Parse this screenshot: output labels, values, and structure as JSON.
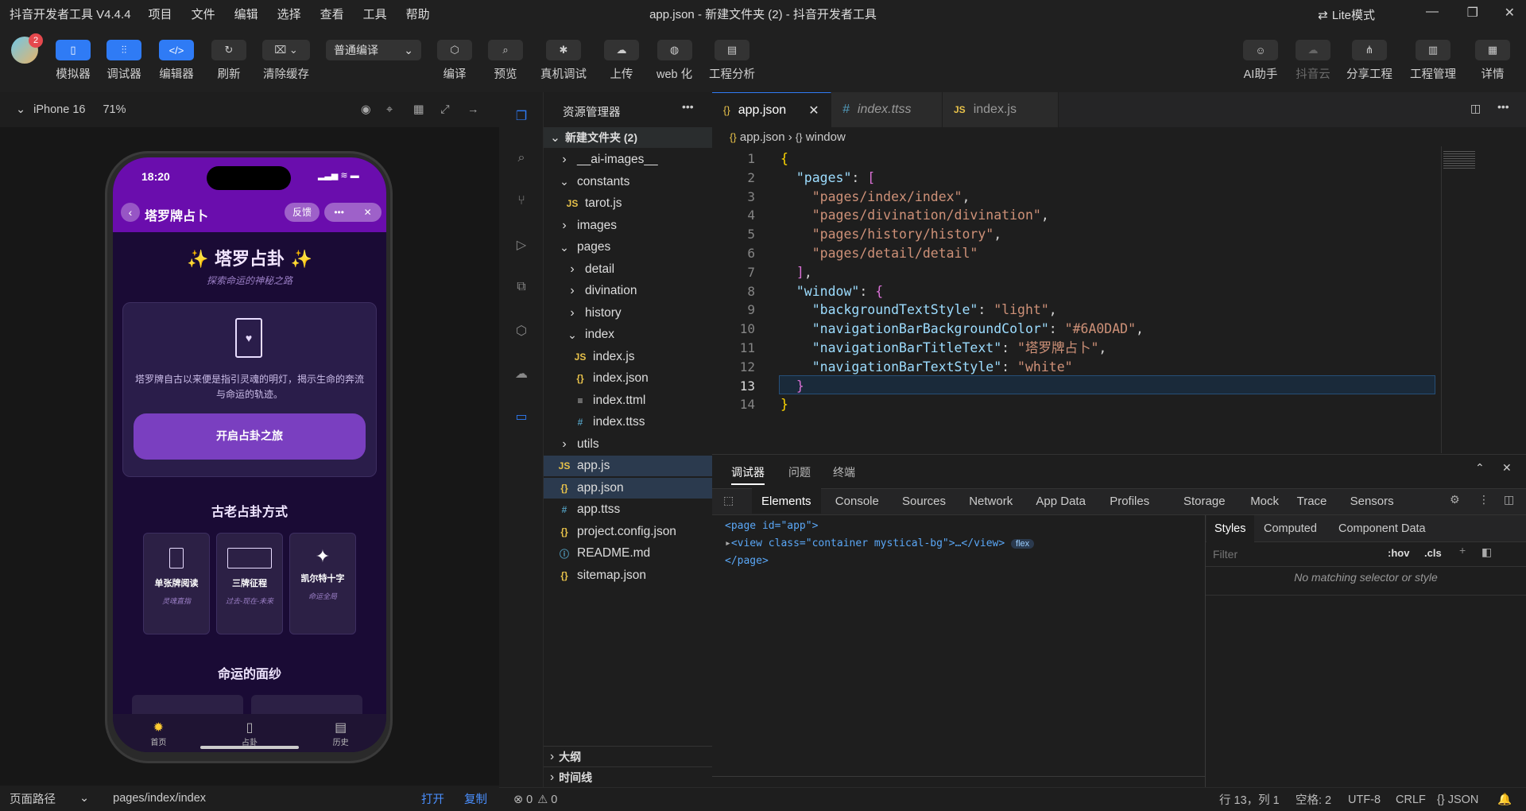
{
  "menubar": {
    "app": "抖音开发者工具 V4.4.4",
    "items": [
      "项目",
      "文件",
      "编辑",
      "选择",
      "查看",
      "工具",
      "帮助"
    ],
    "title": "app.json - 新建文件夹 (2) - 抖音开发者工具",
    "lite": "Lite模式"
  },
  "toolbar": {
    "avatar_badge": "2",
    "simulator": "模拟器",
    "debugger": "调试器",
    "editor": "编辑器",
    "refresh": "刷新",
    "clear_cache": "清除缓存",
    "compile_mode": "普通编译",
    "compile": "编译",
    "preview": "预览",
    "real_debug": "真机调试",
    "upload": "上传",
    "web": "web 化",
    "analysis": "工程分析",
    "ai": "AI助手",
    "cloud": "抖音云",
    "share": "分享工程",
    "manage": "工程管理",
    "detail": "详情"
  },
  "simulator": {
    "device": "iPhone 16",
    "zoom": "71%",
    "path_label": "页面路径",
    "path": "pages/index/index",
    "open": "打开",
    "copy": "复制"
  },
  "phone": {
    "time": "18:20",
    "nav_title": "塔罗牌占卜",
    "feedback": "反馈",
    "hero_title": "✨ 塔罗占卦 ✨",
    "hero_sub": "探索命运的神秘之路",
    "intro": "塔罗牌自古以来便是指引灵魂的明灯，揭示生命的奔流与命运的轨迹。",
    "start_btn": "开启占卦之旅",
    "section1": "古老占卦方式",
    "cards": [
      {
        "title": "单张牌阅读",
        "sub": "灵魂直指"
      },
      {
        "title": "三牌征程",
        "sub": "过去-现在-未来"
      },
      {
        "title": "凯尔特十字",
        "sub": "命运全局"
      }
    ],
    "section2": "命运的面纱",
    "tabbar": [
      "首页",
      "占卦",
      "历史"
    ]
  },
  "explorer": {
    "header": "资源管理器",
    "root": "新建文件夹 (2)",
    "tree": [
      {
        "name": "__ai-images__",
        "type": "folder",
        "depth": 1
      },
      {
        "name": "constants",
        "type": "folder-open",
        "depth": 1
      },
      {
        "name": "tarot.js",
        "type": "js",
        "depth": 2
      },
      {
        "name": "images",
        "type": "folder",
        "depth": 1
      },
      {
        "name": "pages",
        "type": "folder-open",
        "depth": 1
      },
      {
        "name": "detail",
        "type": "folder",
        "depth": 2
      },
      {
        "name": "divination",
        "type": "folder",
        "depth": 2
      },
      {
        "name": "history",
        "type": "folder",
        "depth": 2
      },
      {
        "name": "index",
        "type": "folder-open",
        "depth": 2
      },
      {
        "name": "index.js",
        "type": "js",
        "depth": 3
      },
      {
        "name": "index.json",
        "type": "json",
        "depth": 3
      },
      {
        "name": "index.ttml",
        "type": "ttml",
        "depth": 3
      },
      {
        "name": "index.ttss",
        "type": "ttss",
        "depth": 3
      },
      {
        "name": "utils",
        "type": "folder",
        "depth": 1
      },
      {
        "name": "app.js",
        "type": "js",
        "depth": 1,
        "selected": true
      },
      {
        "name": "app.json",
        "type": "json",
        "depth": 1,
        "selected": true
      },
      {
        "name": "app.ttss",
        "type": "ttss",
        "depth": 1
      },
      {
        "name": "project.config.json",
        "type": "json",
        "depth": 1
      },
      {
        "name": "README.md",
        "type": "md",
        "depth": 1
      },
      {
        "name": "sitemap.json",
        "type": "json",
        "depth": 1
      }
    ],
    "outline": "大纲",
    "timeline": "时间线"
  },
  "editor": {
    "tabs": [
      "app.json",
      "index.ttss",
      "index.js"
    ],
    "breadcrumb_file": "app.json",
    "breadcrumb_node": "window",
    "lines": [
      [
        [
          "b1",
          "{"
        ]
      ],
      [
        [
          "p",
          "  "
        ],
        [
          "k",
          "\"pages\""
        ],
        [
          "p",
          ": "
        ],
        [
          "b2",
          "["
        ]
      ],
      [
        [
          "p",
          "    "
        ],
        [
          "s",
          "\"pages/index/index\""
        ],
        [
          "p",
          ","
        ]
      ],
      [
        [
          "p",
          "    "
        ],
        [
          "s",
          "\"pages/divination/divination\""
        ],
        [
          "p",
          ","
        ]
      ],
      [
        [
          "p",
          "    "
        ],
        [
          "s",
          "\"pages/history/history\""
        ],
        [
          "p",
          ","
        ]
      ],
      [
        [
          "p",
          "    "
        ],
        [
          "s",
          "\"pages/detail/detail\""
        ]
      ],
      [
        [
          "p",
          "  "
        ],
        [
          "b2",
          "]"
        ],
        [
          "p",
          ","
        ]
      ],
      [
        [
          "p",
          "  "
        ],
        [
          "k",
          "\"window\""
        ],
        [
          "p",
          ": "
        ],
        [
          "b2",
          "{"
        ]
      ],
      [
        [
          "p",
          "    "
        ],
        [
          "k",
          "\"backgroundTextStyle\""
        ],
        [
          "p",
          ": "
        ],
        [
          "s",
          "\"light\""
        ],
        [
          "p",
          ","
        ]
      ],
      [
        [
          "p",
          "    "
        ],
        [
          "k",
          "\"navigationBarBackgroundColor\""
        ],
        [
          "p",
          ": "
        ],
        [
          "s",
          "\"#6A0DAD\""
        ],
        [
          "p",
          ","
        ]
      ],
      [
        [
          "p",
          "    "
        ],
        [
          "k",
          "\"navigationBarTitleText\""
        ],
        [
          "p",
          ": "
        ],
        [
          "s",
          "\"塔罗牌占卜\""
        ],
        [
          "p",
          ","
        ]
      ],
      [
        [
          "p",
          "    "
        ],
        [
          "k",
          "\"navigationBarTextStyle\""
        ],
        [
          "p",
          ": "
        ],
        [
          "s",
          "\"white\""
        ]
      ],
      [
        [
          "p",
          "  "
        ],
        [
          "b2",
          "}"
        ]
      ],
      [
        [
          "b1",
          "}"
        ]
      ]
    ]
  },
  "panel": {
    "top_tabs": [
      "调试器",
      "问题",
      "终端"
    ],
    "dev_tabs": [
      "Elements",
      "Console",
      "Sources",
      "Network",
      "App Data",
      "Profiles",
      "Storage",
      "Mock",
      "Trace",
      "Sensors"
    ],
    "dom": [
      "<page id=\"app\">",
      "<view class=\"container mystical-bg\">…</view>",
      "</page>"
    ],
    "flex_badge": "flex",
    "style_tabs": [
      "Styles",
      "Computed",
      "Component Data"
    ],
    "filter_placeholder": "Filter",
    "hov": ":hov",
    "cls": ".cls",
    "no_match": "No matching selector or style"
  },
  "status": {
    "errors": "0",
    "warnings": "0",
    "position": "行 13，列 1",
    "spaces": "空格: 2",
    "encoding": "UTF-8",
    "eol": "CRLF",
    "lang": "JSON"
  },
  "colors": {
    "accent": "#2f7bf5",
    "nav_purple": "#6A0DAD"
  }
}
